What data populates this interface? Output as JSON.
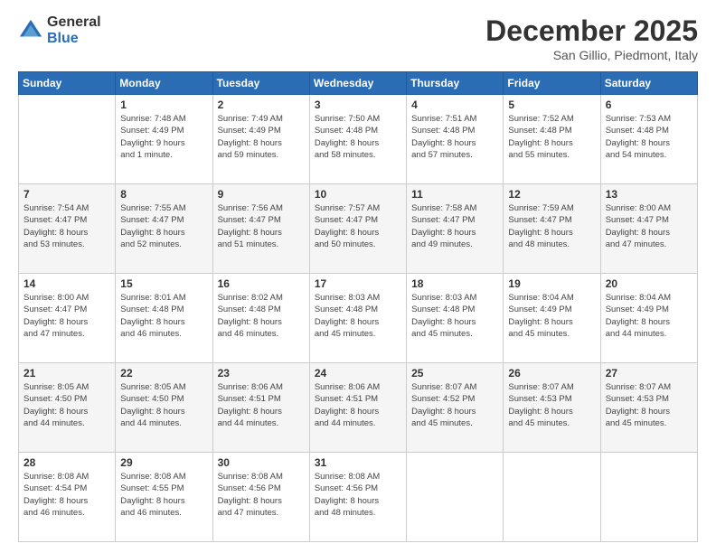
{
  "logo": {
    "general": "General",
    "blue": "Blue"
  },
  "header": {
    "month": "December 2025",
    "location": "San Gillio, Piedmont, Italy"
  },
  "days_of_week": [
    "Sunday",
    "Monday",
    "Tuesday",
    "Wednesday",
    "Thursday",
    "Friday",
    "Saturday"
  ],
  "weeks": [
    [
      {
        "day": "",
        "info": ""
      },
      {
        "day": "1",
        "info": "Sunrise: 7:48 AM\nSunset: 4:49 PM\nDaylight: 9 hours\nand 1 minute."
      },
      {
        "day": "2",
        "info": "Sunrise: 7:49 AM\nSunset: 4:49 PM\nDaylight: 8 hours\nand 59 minutes."
      },
      {
        "day": "3",
        "info": "Sunrise: 7:50 AM\nSunset: 4:48 PM\nDaylight: 8 hours\nand 58 minutes."
      },
      {
        "day": "4",
        "info": "Sunrise: 7:51 AM\nSunset: 4:48 PM\nDaylight: 8 hours\nand 57 minutes."
      },
      {
        "day": "5",
        "info": "Sunrise: 7:52 AM\nSunset: 4:48 PM\nDaylight: 8 hours\nand 55 minutes."
      },
      {
        "day": "6",
        "info": "Sunrise: 7:53 AM\nSunset: 4:48 PM\nDaylight: 8 hours\nand 54 minutes."
      }
    ],
    [
      {
        "day": "7",
        "info": "Sunrise: 7:54 AM\nSunset: 4:47 PM\nDaylight: 8 hours\nand 53 minutes."
      },
      {
        "day": "8",
        "info": "Sunrise: 7:55 AM\nSunset: 4:47 PM\nDaylight: 8 hours\nand 52 minutes."
      },
      {
        "day": "9",
        "info": "Sunrise: 7:56 AM\nSunset: 4:47 PM\nDaylight: 8 hours\nand 51 minutes."
      },
      {
        "day": "10",
        "info": "Sunrise: 7:57 AM\nSunset: 4:47 PM\nDaylight: 8 hours\nand 50 minutes."
      },
      {
        "day": "11",
        "info": "Sunrise: 7:58 AM\nSunset: 4:47 PM\nDaylight: 8 hours\nand 49 minutes."
      },
      {
        "day": "12",
        "info": "Sunrise: 7:59 AM\nSunset: 4:47 PM\nDaylight: 8 hours\nand 48 minutes."
      },
      {
        "day": "13",
        "info": "Sunrise: 8:00 AM\nSunset: 4:47 PM\nDaylight: 8 hours\nand 47 minutes."
      }
    ],
    [
      {
        "day": "14",
        "info": "Sunrise: 8:00 AM\nSunset: 4:47 PM\nDaylight: 8 hours\nand 47 minutes."
      },
      {
        "day": "15",
        "info": "Sunrise: 8:01 AM\nSunset: 4:48 PM\nDaylight: 8 hours\nand 46 minutes."
      },
      {
        "day": "16",
        "info": "Sunrise: 8:02 AM\nSunset: 4:48 PM\nDaylight: 8 hours\nand 46 minutes."
      },
      {
        "day": "17",
        "info": "Sunrise: 8:03 AM\nSunset: 4:48 PM\nDaylight: 8 hours\nand 45 minutes."
      },
      {
        "day": "18",
        "info": "Sunrise: 8:03 AM\nSunset: 4:48 PM\nDaylight: 8 hours\nand 45 minutes."
      },
      {
        "day": "19",
        "info": "Sunrise: 8:04 AM\nSunset: 4:49 PM\nDaylight: 8 hours\nand 45 minutes."
      },
      {
        "day": "20",
        "info": "Sunrise: 8:04 AM\nSunset: 4:49 PM\nDaylight: 8 hours\nand 44 minutes."
      }
    ],
    [
      {
        "day": "21",
        "info": "Sunrise: 8:05 AM\nSunset: 4:50 PM\nDaylight: 8 hours\nand 44 minutes."
      },
      {
        "day": "22",
        "info": "Sunrise: 8:05 AM\nSunset: 4:50 PM\nDaylight: 8 hours\nand 44 minutes."
      },
      {
        "day": "23",
        "info": "Sunrise: 8:06 AM\nSunset: 4:51 PM\nDaylight: 8 hours\nand 44 minutes."
      },
      {
        "day": "24",
        "info": "Sunrise: 8:06 AM\nSunset: 4:51 PM\nDaylight: 8 hours\nand 44 minutes."
      },
      {
        "day": "25",
        "info": "Sunrise: 8:07 AM\nSunset: 4:52 PM\nDaylight: 8 hours\nand 45 minutes."
      },
      {
        "day": "26",
        "info": "Sunrise: 8:07 AM\nSunset: 4:53 PM\nDaylight: 8 hours\nand 45 minutes."
      },
      {
        "day": "27",
        "info": "Sunrise: 8:07 AM\nSunset: 4:53 PM\nDaylight: 8 hours\nand 45 minutes."
      }
    ],
    [
      {
        "day": "28",
        "info": "Sunrise: 8:08 AM\nSunset: 4:54 PM\nDaylight: 8 hours\nand 46 minutes."
      },
      {
        "day": "29",
        "info": "Sunrise: 8:08 AM\nSunset: 4:55 PM\nDaylight: 8 hours\nand 46 minutes."
      },
      {
        "day": "30",
        "info": "Sunrise: 8:08 AM\nSunset: 4:56 PM\nDaylight: 8 hours\nand 47 minutes."
      },
      {
        "day": "31",
        "info": "Sunrise: 8:08 AM\nSunset: 4:56 PM\nDaylight: 8 hours\nand 48 minutes."
      },
      {
        "day": "",
        "info": ""
      },
      {
        "day": "",
        "info": ""
      },
      {
        "day": "",
        "info": ""
      }
    ]
  ]
}
